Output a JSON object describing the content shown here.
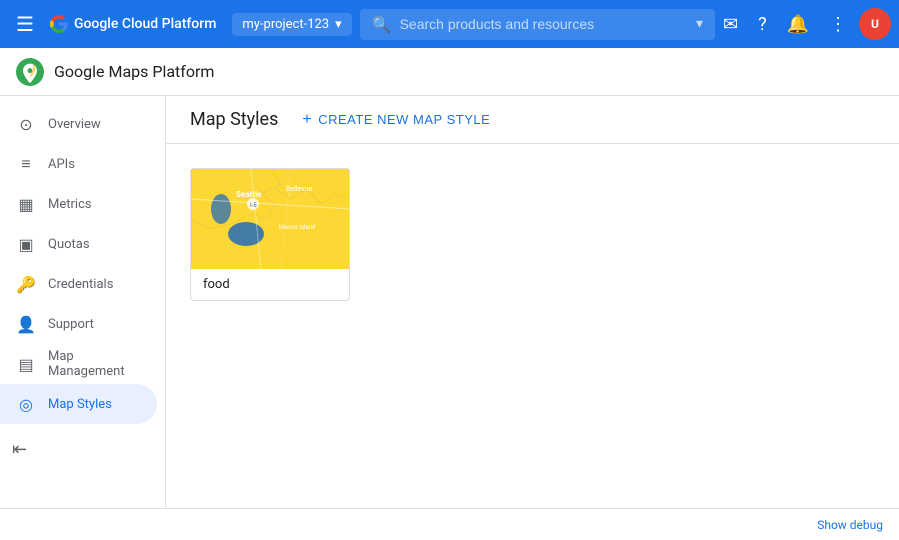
{
  "topbar": {
    "menu_icon": "☰",
    "logo_text": "Google Cloud Platform",
    "project_name": "my-project-123",
    "search_placeholder": "Search products and resources",
    "dropdown_icon": "▾",
    "email_icon": "✉",
    "help_icon": "?",
    "notification_icon": "🔔",
    "more_icon": "⋮",
    "avatar_initials": "U"
  },
  "product_header": {
    "product_name": "Google Maps Platform"
  },
  "content_header": {
    "title": "Map Styles",
    "create_btn_icon": "+",
    "create_btn_label": "CREATE NEW MAP STYLE"
  },
  "sidebar": {
    "items": [
      {
        "id": "overview",
        "label": "Overview",
        "icon": "⊙",
        "active": false
      },
      {
        "id": "apis",
        "label": "APIs",
        "icon": "≡",
        "active": false
      },
      {
        "id": "metrics",
        "label": "Metrics",
        "icon": "▦",
        "active": false
      },
      {
        "id": "quotas",
        "label": "Quotas",
        "icon": "▣",
        "active": false
      },
      {
        "id": "credentials",
        "label": "Credentials",
        "icon": "🔑",
        "active": false
      },
      {
        "id": "support",
        "label": "Support",
        "icon": "👤",
        "active": false
      },
      {
        "id": "map-management",
        "label": "Map Management",
        "icon": "▤",
        "active": false
      },
      {
        "id": "map-styles",
        "label": "Map Styles",
        "icon": "◎",
        "active": true
      }
    ]
  },
  "map_card": {
    "label": "food"
  },
  "bottom_bar": {
    "debug_link": "Show debug"
  },
  "colors": {
    "active": "#1a73e8",
    "topbar_bg": "#1a73e8",
    "map_blue": "#1565c0",
    "map_yellow": "#fdd835",
    "map_light_blue": "#64b5f6"
  }
}
